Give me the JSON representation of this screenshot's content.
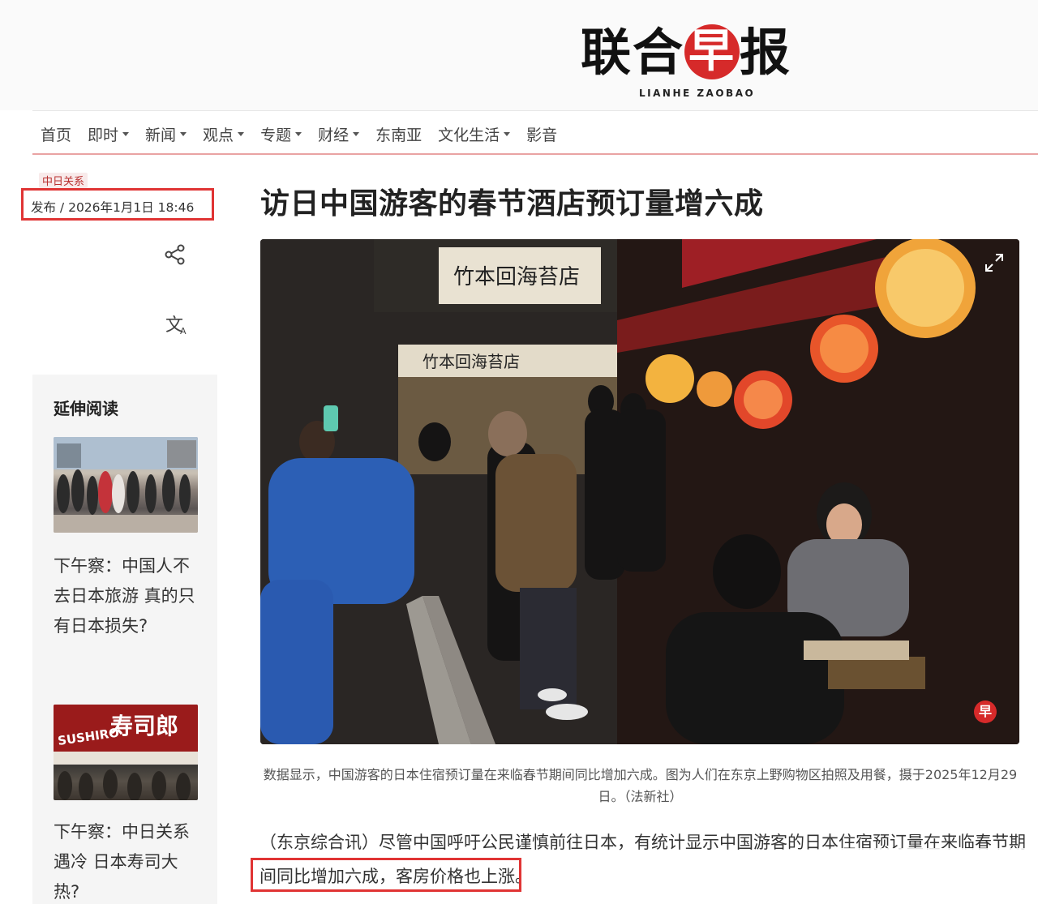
{
  "masthead": {
    "logo_cn": "联合",
    "logo_zao": "早",
    "logo_cn_end": "报",
    "logo_en": "LIANHE ZAOBAO"
  },
  "nav": {
    "items": [
      {
        "label": "首页",
        "dropdown": false
      },
      {
        "label": "即时",
        "dropdown": true
      },
      {
        "label": "新闻",
        "dropdown": true
      },
      {
        "label": "观点",
        "dropdown": true
      },
      {
        "label": "专题",
        "dropdown": true
      },
      {
        "label": "财经",
        "dropdown": true
      },
      {
        "label": "东南亚",
        "dropdown": false
      },
      {
        "label": "文化生活",
        "dropdown": true
      },
      {
        "label": "影音",
        "dropdown": false
      }
    ]
  },
  "article": {
    "category": "中日关系",
    "publish": "发布 / 2026年1月1日 18:46",
    "headline": "访日中国游客的春节酒店预订量增六成",
    "photo_badge": "早",
    "caption": "数据显示，中国游客的日本住宿预订量在来临春节期间同比增加六成。图为人们在东京上野购物区拍照及用餐，摄于2025年12月29日。（法新社）",
    "body_prefix": "（东京综合讯）尽管中国呼吁公民谨慎前往日本，有统计显示中国游客的日本住宿预订量",
    "body_highlight": "在来临春节期间同比增加六成，",
    "body_suffix": "客房价格也上涨。"
  },
  "sidebar": {
    "title": "延伸阅读",
    "items": [
      {
        "text": "下午察：中国人不去日本旅游 真的只有日本损失?"
      },
      {
        "text": "下午察：中日关系遇冷 日本寿司大热?"
      }
    ]
  },
  "icons": {
    "share": "share-icon",
    "translate": "translate-icon",
    "expand": "expand-icon"
  },
  "colors": {
    "accent_red": "#d62a2a",
    "annotation_red": "#e03434",
    "nav_rule": "#e9a3a3"
  }
}
